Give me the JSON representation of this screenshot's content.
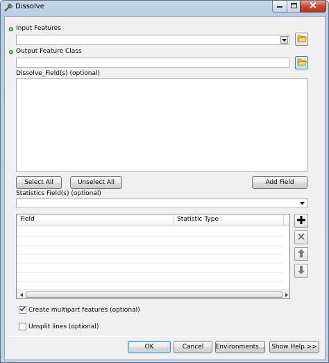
{
  "window": {
    "title": "Dissolve"
  },
  "input_features": {
    "label": "Input Features",
    "value": ""
  },
  "output_feature_class": {
    "label": "Output Feature Class",
    "value": ""
  },
  "dissolve_fields": {
    "label": "Dissolve_Field(s) (optional)",
    "items": []
  },
  "buttons": {
    "select_all": "Select All",
    "unselect_all": "Unselect All",
    "add_field": "Add Field",
    "ok": "OK",
    "cancel": "Cancel",
    "environments": "Environments...",
    "show_help": "Show Help >>"
  },
  "statistics": {
    "label": "Statistics Field(s) (optional)",
    "value": "",
    "columns": [
      "Field",
      "Statistic Type"
    ],
    "rows": []
  },
  "options": {
    "multipart": {
      "label": "Create multipart features (optional)",
      "checked": true
    },
    "unsplit": {
      "label": "Unsplit lines (optional)",
      "checked": false
    }
  },
  "colors": {
    "required_dot": "#28a020",
    "close_button": "#c8492d"
  },
  "icons": [
    "hammer-icon",
    "minimize-icon",
    "maximize-icon",
    "close-icon",
    "folder-open-icon",
    "plus-icon",
    "delete-x-icon",
    "arrow-up-icon",
    "arrow-down-icon",
    "checkmark-icon"
  ]
}
